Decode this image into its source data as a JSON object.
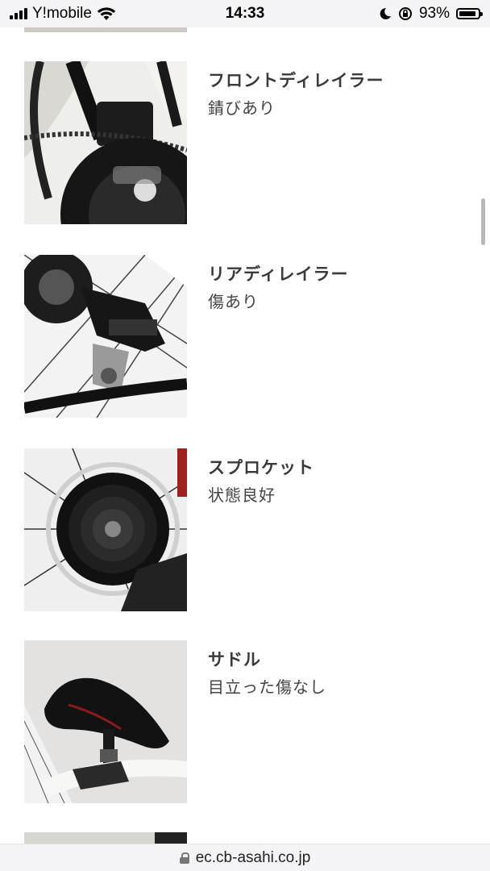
{
  "status_bar": {
    "carrier": "Y!mobile",
    "time": "14:33",
    "battery_percent": "93%",
    "battery_level": 0.93,
    "icons": [
      "signal-icon",
      "wifi-icon",
      "moon-icon",
      "rotation-lock-icon",
      "battery-icon"
    ]
  },
  "parts": [
    {
      "title": "フロントディレイラー",
      "status": "錆びあり",
      "image": "front-derailleur-photo"
    },
    {
      "title": "リアディレイラー",
      "status": "傷あり",
      "image": "rear-derailleur-photo"
    },
    {
      "title": "スプロケット",
      "status": "状態良好",
      "image": "sprocket-photo"
    },
    {
      "title": "サドル",
      "status": "目立った傷なし",
      "image": "saddle-photo"
    }
  ],
  "url_bar": {
    "url": "ec.cb-asahi.co.jp",
    "icon": "lock-icon"
  },
  "colors": {
    "bar_background": "#f4f4f6",
    "text": "#333333"
  }
}
